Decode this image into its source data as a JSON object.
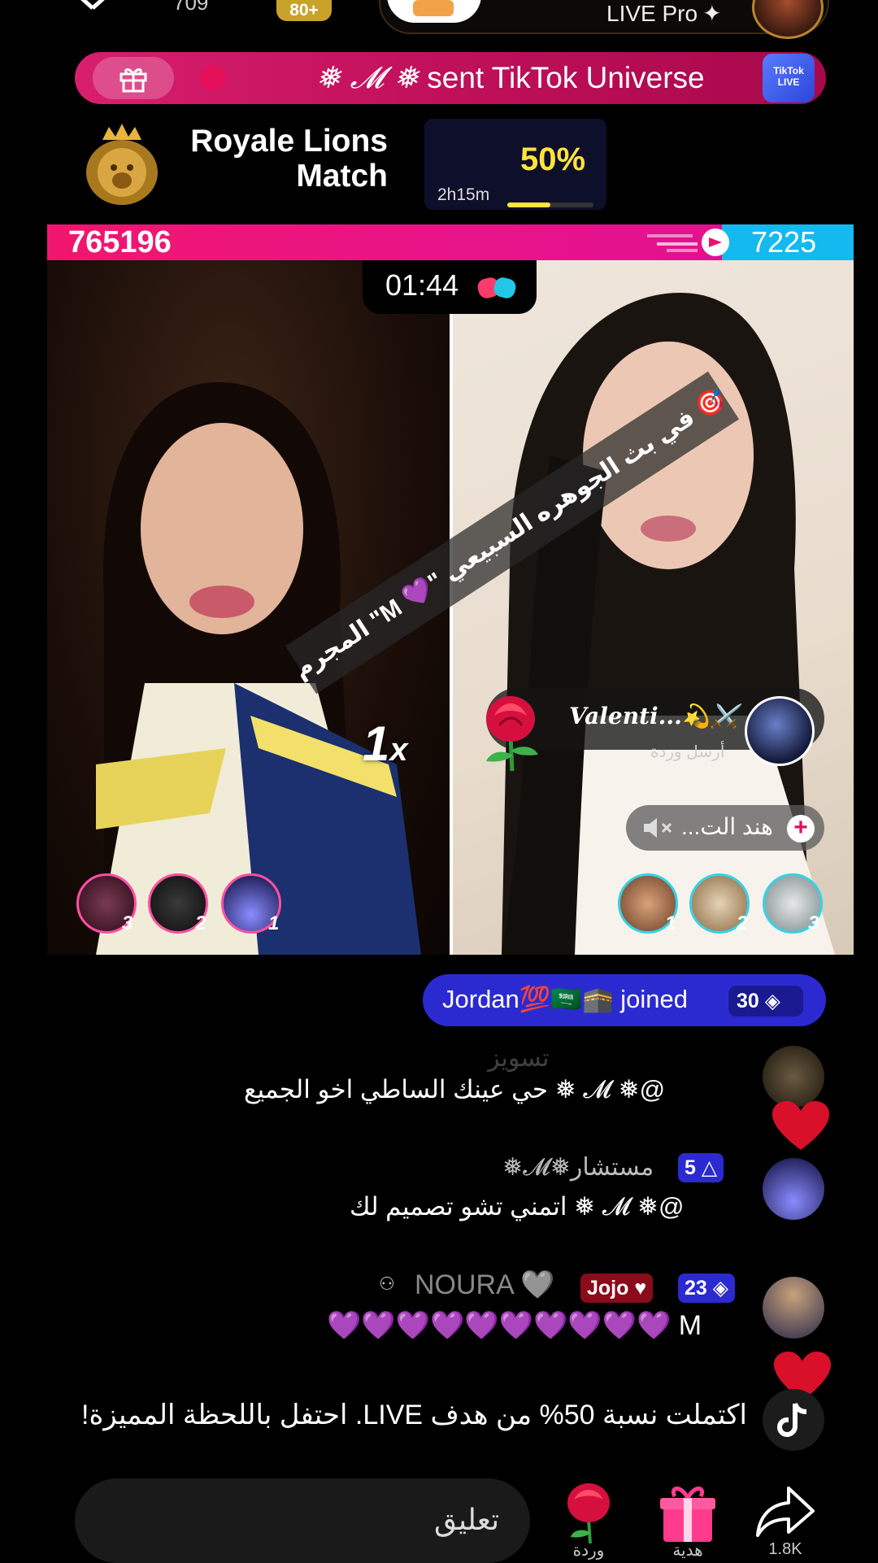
{
  "top": {
    "viewer_count": "709",
    "count_badge": "80+",
    "live_pro": "LIVE Pro"
  },
  "gift_banner": {
    "text": "sent TikTok Universe",
    "sender": "❅ 𝓜 ❅",
    "gift_image_text": "TikTok LIVE"
  },
  "match": {
    "title_line1": "Royale Lions",
    "title_line2": "Match",
    "percent": "50%",
    "time_left": "2h15m",
    "progress": 0.5
  },
  "battle": {
    "score_left": "765196",
    "score_right": "7225",
    "timer": "01:44",
    "overlay_text": "🎯 في بث الجوهره السبيعي \"💜 M\" المجرم",
    "multiplier": "1",
    "multiplier_suffix": "x",
    "gift_toast": {
      "name": "Valenti...💫⚔️",
      "action": "أرسل وردة"
    },
    "mute_chip": "هند الت...",
    "left_supporters": [
      {
        "rank": "3"
      },
      {
        "rank": "2"
      },
      {
        "rank": "1"
      }
    ],
    "right_supporters": [
      {
        "rank": "1"
      },
      {
        "rank": "2"
      },
      {
        "rank": "3"
      }
    ]
  },
  "chat": {
    "joined": {
      "name": "Jordan💯🇸🇦🕋",
      "text": "joined",
      "badge": "30"
    },
    "messages": [
      {
        "name": "تسويز",
        "text": "@❅ 𝓜 ❅ حي عينك الساطي اخو الجميع"
      },
      {
        "name": "مستشار❅𝓜❅",
        "level": "5",
        "text": "@❅ 𝓜 ❅ اتمني تشو تصميم لك"
      },
      {
        "name": "NOURA 🩶",
        "fan_badge": "Jojo",
        "level": "23",
        "text": "M 💜💜💜💜💜💜💜💜💜💜"
      }
    ],
    "notice": "اكتملت نسبة 50% من هدف LIVE. احتفل باللحظة المميزة!"
  },
  "bottom": {
    "comment_placeholder": "تعليق",
    "rose_label": "وردة",
    "gift_label": "هدية",
    "share_count": "1.8K"
  },
  "colors": {
    "pink": "#e8146f",
    "blue": "#14b9f0",
    "yellow": "#ffe43a",
    "chip_blue": "#2b2ad1"
  }
}
